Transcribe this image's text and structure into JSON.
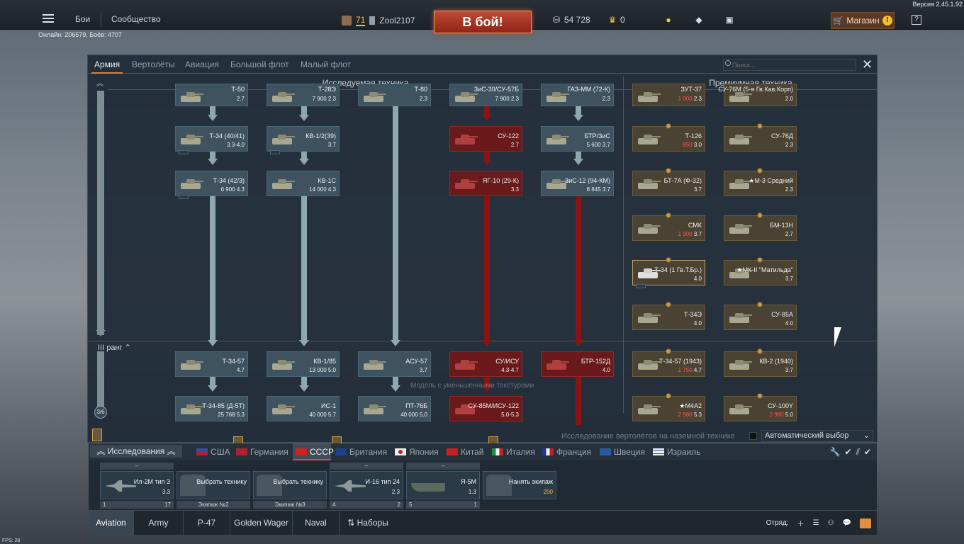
{
  "header": {
    "version": "Версия 2.45.1.92",
    "menu": [
      "Бои",
      "Сообщество"
    ],
    "online": "Онлайн: 206579, Боёв: 4707",
    "player_level": "71",
    "player_name": "Zool2107",
    "battle_button": "В бой!",
    "silver": "54 728",
    "gold": "0",
    "shop": "Магазин",
    "help": "?"
  },
  "tabs": [
    "Армия",
    "Вертолёты",
    "Авиация",
    "Большой флот",
    "Малый флот"
  ],
  "search": {
    "placeholder": "Поиск..."
  },
  "columns": {
    "research": "Исследуемая техника",
    "premium": "Премиумная техника"
  },
  "rank": {
    "label": "III ранг",
    "count": "3/6"
  },
  "vehicles": [
    {
      "name": "Т-50",
      "info": "2.7"
    },
    {
      "name": "Т-28Э",
      "info": "7 900 2.3"
    },
    {
      "name": "Т-80",
      "info": "2.3"
    },
    {
      "name": "ЗиС-30/СУ-57Б",
      "info": "7 900 2.3"
    },
    {
      "name": "ГАЗ-ММ (72-К)",
      "info": "2.3"
    },
    {
      "name": "Т-34 (40/41)",
      "info": "3.3-4.0"
    },
    {
      "name": "КВ-1/2(39)",
      "info": "3.7"
    },
    {
      "name": "СУ-122",
      "info": "2.7"
    },
    {
      "name": "БТР/ЗиС",
      "info": "5 600 3.7"
    },
    {
      "name": "Т-34 (42/3)",
      "info": "6 900 4.3"
    },
    {
      "name": "КВ-1С",
      "info": "14 000 4.3"
    },
    {
      "name": "ЯГ-10 (29-К)",
      "info": "3.3"
    },
    {
      "name": "ЗиС-12 (94-КМ)",
      "info": "8 845 3.7"
    },
    {
      "name": "Т-34-57",
      "info": "4.7"
    },
    {
      "name": "КВ-1/85",
      "info": "13 000 5.0"
    },
    {
      "name": "АСУ-57",
      "info": "3.7"
    },
    {
      "name": "СУ/ИСУ",
      "info": "4.3-4.7"
    },
    {
      "name": "БТР-152Д",
      "info": "4.0"
    },
    {
      "name": "Т-34-85 (Д-5Т)",
      "info": "25 768 5.3"
    },
    {
      "name": "ИС-1",
      "info": "40 000 5.7"
    },
    {
      "name": "ПТ-76Б",
      "info": "40 000 5.0"
    },
    {
      "name": "СУ-85М/ИСУ-122",
      "info": "5.0-5.3"
    }
  ],
  "premium": [
    {
      "name": "ЗУТ-37",
      "cost": "1 000",
      "br": "2.3"
    },
    {
      "name": "СУ-76М (5-я Гв.Кав.Корп)",
      "cost": "",
      "br": "2.0"
    },
    {
      "name": "Т-126",
      "cost": "850",
      "br": "3.0"
    },
    {
      "name": "СУ-76Д",
      "cost": "",
      "br": "2.3"
    },
    {
      "name": "БТ-7А (Ф-32)",
      "cost": "",
      "br": "3.7"
    },
    {
      "name": "★М-3 Средний",
      "cost": "",
      "br": "2.3"
    },
    {
      "name": "СМК",
      "cost": "1 300",
      "br": "3.7"
    },
    {
      "name": "БМ-13Н",
      "cost": "",
      "br": "2.7"
    },
    {
      "name": "Т-34 (1 Гв.Т.Бр.)",
      "cost": "",
      "br": "4.0"
    },
    {
      "name": "★МК-II \"Матильда\"",
      "cost": "",
      "br": "3.7"
    },
    {
      "name": "Т-34Э",
      "cost": "",
      "br": "4.0"
    },
    {
      "name": "СУ-85А",
      "cost": "",
      "br": "4.0"
    },
    {
      "name": "Т-34-57 (1943)",
      "cost": "1 750",
      "br": "4.7"
    },
    {
      "name": "КВ-2 (1940)",
      "cost": "",
      "br": "3.7"
    },
    {
      "name": "★М4А2",
      "cost": "2 980",
      "br": "5.3"
    },
    {
      "name": "СУ-100Y",
      "cost": "2 980",
      "br": "5.0"
    }
  ],
  "watermark": "Модель с уменьшенными текстурами",
  "heli_research": "Исследование вертолётов на наземной технике",
  "auto_select": "Автоматический выбор",
  "research_label": "Исследования",
  "nations": [
    "США",
    "Германия",
    "СССР",
    "Британия",
    "Япония",
    "Китай",
    "Италия",
    "Франция",
    "Швеция",
    "Израиль"
  ],
  "crew_slots": [
    {
      "top": "–",
      "name": "Ил-2М тип 3",
      "info": "3.3",
      "left": "1",
      "right": "17"
    },
    {
      "top": "",
      "name": "Выбрать технику",
      "info": "",
      "bottom": "Экипаж №2"
    },
    {
      "top": "",
      "name": "Выбрать технику",
      "info": "",
      "bottom": "Экипаж №3"
    },
    {
      "top": "–",
      "name": "И-16 тип 24",
      "info": "2.3",
      "left": "4",
      "right": "2"
    },
    {
      "top": "–",
      "name": "Я-5М",
      "info": "1.3",
      "left": "5",
      "right": "1"
    },
    {
      "top": "",
      "name": "Нанять экипаж",
      "info": "200",
      "bottom": ""
    }
  ],
  "presets": [
    "Aviation",
    "Army",
    "P-47",
    "Golden Wager",
    "Naval",
    "Наборы"
  ],
  "squad_label": "Отряд:",
  "fps": "FPS: 28"
}
